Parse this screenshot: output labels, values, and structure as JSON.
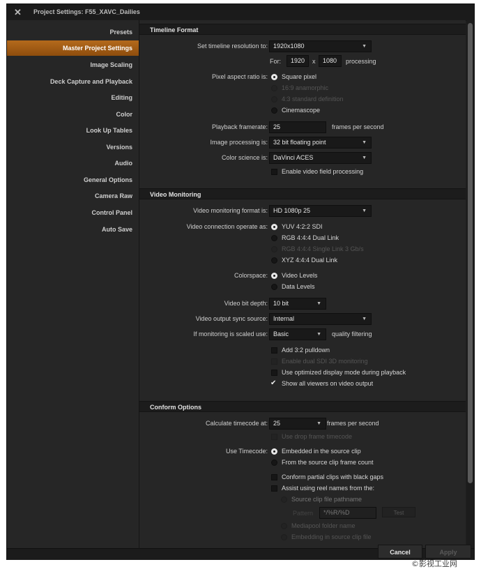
{
  "window": {
    "title": "Project Settings:  F55_XAVC_Dailies"
  },
  "sidebar": {
    "items": [
      {
        "label": "Presets"
      },
      {
        "label": "Master Project Settings"
      },
      {
        "label": "Image Scaling"
      },
      {
        "label": "Deck Capture and Playback"
      },
      {
        "label": "Editing"
      },
      {
        "label": "Color"
      },
      {
        "label": "Look Up Tables"
      },
      {
        "label": "Versions"
      },
      {
        "label": "Audio"
      },
      {
        "label": "General Options"
      },
      {
        "label": "Camera Raw"
      },
      {
        "label": "Control Panel"
      },
      {
        "label": "Auto Save"
      }
    ],
    "active_index": 1
  },
  "timeline": {
    "header": "Timeline Format",
    "resolution_label": "Set timeline resolution to:",
    "resolution_value": "1920x1080",
    "for_label": "For:",
    "width_value": "1920",
    "x_label": "x",
    "height_value": "1080",
    "processing_label": "processing",
    "pixel_aspect_label": "Pixel aspect ratio is:",
    "pixel_aspect_options": [
      "Square pixel",
      "16:9 anamorphic",
      "4:3 standard definition",
      "Cinemascope"
    ],
    "framerate_label": "Playback framerate:",
    "framerate_value": "25",
    "fps_label": "frames per second",
    "image_processing_label": "Image processing is:",
    "image_processing_value": "32 bit floating point",
    "color_science_label": "Color science is:",
    "color_science_value": "DaVinci ACES",
    "field_processing_label": "Enable video field processing"
  },
  "monitoring": {
    "header": "Video Monitoring",
    "format_label": "Video monitoring format is:",
    "format_value": "HD 1080p 25",
    "connection_label": "Video connection operate as:",
    "connection_options": [
      "YUV 4:2:2 SDI",
      "RGB 4:4:4 Dual Link",
      "RGB 4:4:4 Single Link 3 Gb/s",
      "XYZ 4:4:4 Dual Link"
    ],
    "colorspace_label": "Colorspace:",
    "colorspace_options": [
      "Video Levels",
      "Data Levels"
    ],
    "bit_depth_label": "Video bit depth:",
    "bit_depth_value": "10 bit",
    "sync_label": "Video output sync source:",
    "sync_value": "Internal",
    "scaled_label": "If monitoring is scaled use:",
    "scaled_value": "Basic",
    "quality_label": "quality filtering",
    "checks": [
      "Add 3:2 pulldown",
      "Enable dual SDI 3D monitoring",
      "Use optimized display mode during playback",
      "Show all viewers on video output"
    ]
  },
  "conform": {
    "header": "Conform Options",
    "timecode_label": "Calculate timecode at:",
    "timecode_value": "25",
    "fps_label": "frames per second",
    "drop_frame_label": "Use drop frame timecode",
    "use_timecode_label": "Use Timecode:",
    "timecode_options": [
      "Embedded in the source clip",
      "From the source clip frame count"
    ],
    "black_gaps_label": "Conform partial clips with black gaps",
    "reel_names_label": "Assist using reel names from the:",
    "source_path_label": "Source clip file pathname",
    "pattern_label": "Pattern",
    "pattern_value": "*/%R/%D",
    "test_label": "Test",
    "mediapool_label": "Mediapool folder name",
    "embedding_label": "Embedding in source clip file"
  },
  "footer": {
    "cancel_label": "Cancel",
    "apply_label": "Apply"
  },
  "watermark": "©影视工业网"
}
